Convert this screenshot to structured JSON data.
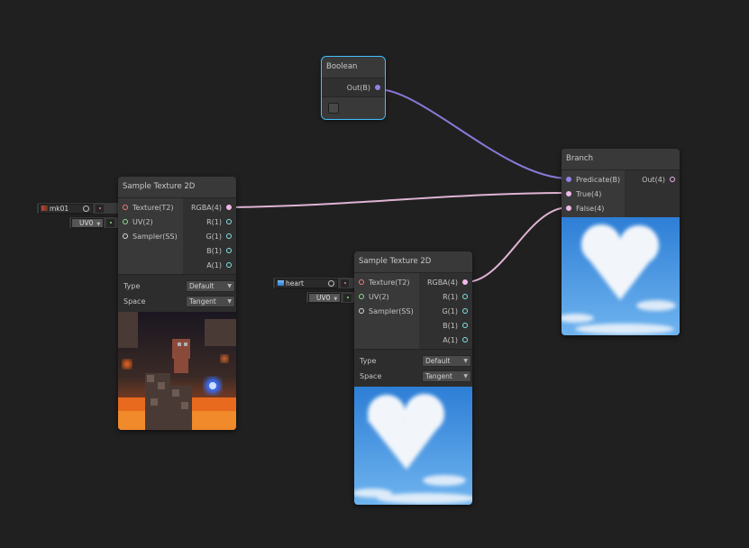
{
  "nodes": {
    "boolean": {
      "title": "Boolean",
      "outputs": [
        {
          "label": "Out(B)",
          "type": "bool"
        }
      ],
      "checkbox_checked": false
    },
    "branch": {
      "title": "Branch",
      "inputs": [
        {
          "label": "Predicate(B)",
          "type": "bool"
        },
        {
          "label": "True(4)",
          "type": "vec4"
        },
        {
          "label": "False(4)",
          "type": "vec4"
        }
      ],
      "outputs": [
        {
          "label": "Out(4)",
          "type": "vec4"
        }
      ],
      "preview": "heart-cloud-sky"
    },
    "sample_texture_1": {
      "title": "Sample Texture 2D",
      "inputs": [
        {
          "label": "Texture(T2)",
          "type": "texture"
        },
        {
          "label": "UV(2)",
          "type": "uv"
        },
        {
          "label": "Sampler(SS)",
          "type": "sampler"
        }
      ],
      "outputs": [
        {
          "label": "RGBA(4)",
          "type": "vec4"
        },
        {
          "label": "R(1)",
          "type": "float"
        },
        {
          "label": "G(1)",
          "type": "float"
        },
        {
          "label": "B(1)",
          "type": "float"
        },
        {
          "label": "A(1)",
          "type": "float"
        }
      ],
      "properties": [
        {
          "label": "Type",
          "value": "Default"
        },
        {
          "label": "Space",
          "value": "Tangent"
        }
      ],
      "preview": "minecraft-dungeon-scene",
      "texture_field": "mk01",
      "uv_field": "UV0"
    },
    "sample_texture_2": {
      "title": "Sample Texture 2D",
      "inputs": [
        {
          "label": "Texture(T2)",
          "type": "texture"
        },
        {
          "label": "UV(2)",
          "type": "uv"
        },
        {
          "label": "Sampler(SS)",
          "type": "sampler"
        }
      ],
      "outputs": [
        {
          "label": "RGBA(4)",
          "type": "vec4"
        },
        {
          "label": "R(1)",
          "type": "float"
        },
        {
          "label": "G(1)",
          "type": "float"
        },
        {
          "label": "B(1)",
          "type": "float"
        },
        {
          "label": "A(1)",
          "type": "float"
        }
      ],
      "properties": [
        {
          "label": "Type",
          "value": "Default"
        },
        {
          "label": "Space",
          "value": "Tangent"
        }
      ],
      "preview": "heart-cloud-sky",
      "texture_field": "heart",
      "uv_field": "UV0"
    }
  },
  "colors": {
    "background": "#202020",
    "selection": "#44c0ff",
    "bool_port": "#9481e6",
    "vec4_port": "#f0b8e8",
    "float_port": "#84e4e7",
    "texture_port": "#f07a7a",
    "uv_port": "#8ae08a"
  },
  "icons": [
    "picker-icon",
    "dropdown-arrow-icon",
    "texture-thumbnail-icon"
  ]
}
